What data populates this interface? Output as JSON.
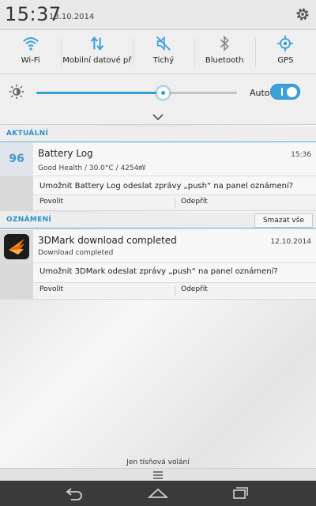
{
  "status": {
    "time": "15:37",
    "date": "13.10.2014"
  },
  "quick_settings": [
    {
      "label": "Wi-Fi",
      "icon": "wifi-icon"
    },
    {
      "label": "Mobilní datové př",
      "icon": "mobile-data-icon"
    },
    {
      "label": "Tichý",
      "icon": "silent-icon"
    },
    {
      "label": "Bluetooth",
      "icon": "bluetooth-icon"
    },
    {
      "label": "GPS",
      "icon": "gps-icon"
    }
  ],
  "brightness": {
    "auto_label": "Auto",
    "level": 0.63,
    "auto_enabled": true
  },
  "sections": {
    "current": "AKTUÁLNÍ",
    "notifications": "OZNÁMENÍ",
    "clear_all": "Smazat vše"
  },
  "notifications": [
    {
      "app": "Battery Log",
      "icon_text": "96",
      "subtitle": "Good Health / 30.0°C / 4254㎷",
      "time": "15:36",
      "question": "Umožnit Battery Log odeslat zprávy „push“ na panel oznámení?",
      "allow": "Povolit",
      "deny": "Odepřít"
    },
    {
      "app": "3DMark download completed",
      "subtitle": "Download completed",
      "time": "12.10.2014",
      "question": "Umožnit 3DMark odeslat zprávy „push“ na panel oznámení?",
      "allow": "Povolit",
      "deny": "Odepřít"
    }
  ],
  "footer": {
    "emergency": "Jen tísňová volání"
  },
  "colors": {
    "accent": "#38a0d6",
    "header_text": "#2a90c8"
  }
}
